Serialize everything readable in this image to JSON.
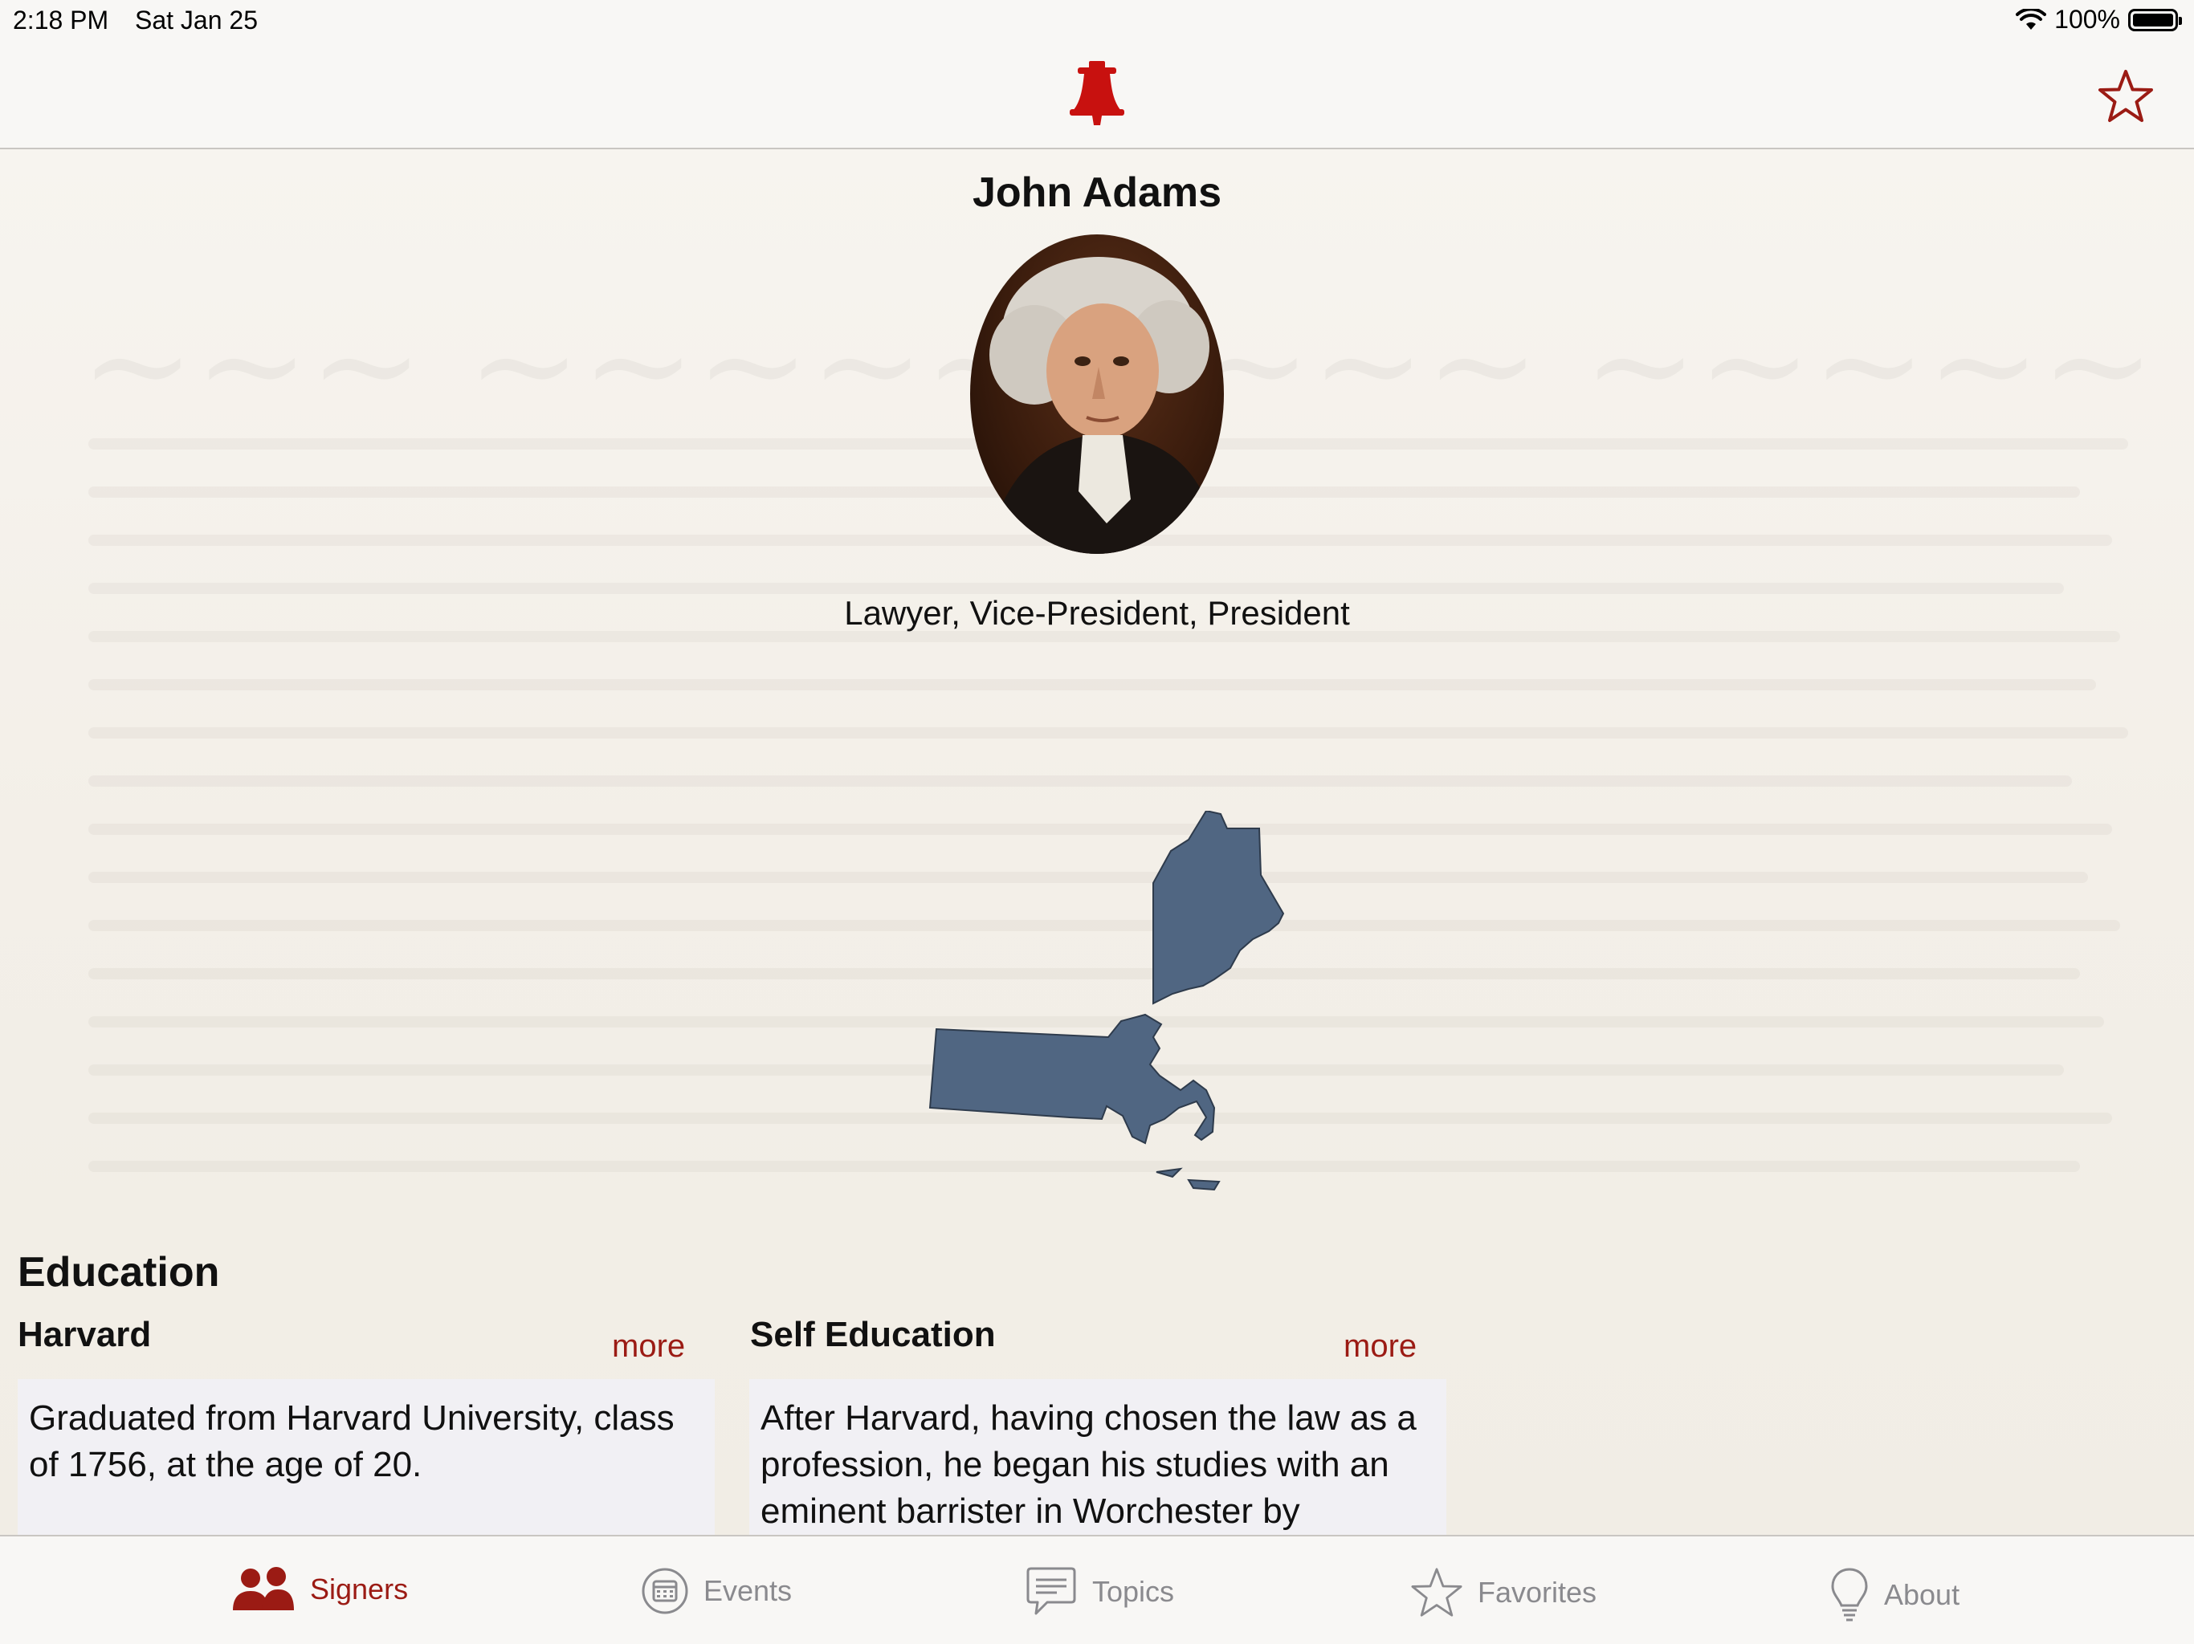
{
  "status_bar": {
    "time": "2:18 PM",
    "date": "Sat Jan 25",
    "battery": "100%",
    "wifi_icon": "wifi-icon",
    "battery_icon": "battery-icon"
  },
  "nav": {
    "logo_icon": "liberty-bell-icon",
    "favorite_icon": "star-outline-icon"
  },
  "signer": {
    "name": "John Adams",
    "roles": "Lawyer, Vice-President, President",
    "state_map_icon": "massachusetts-maine-map"
  },
  "education": {
    "title": "Education",
    "cards": [
      {
        "title": "Harvard",
        "more": "more",
        "text": "Graduated from Harvard University, class of 1756, at the age of 20."
      },
      {
        "title": "Self Education",
        "more": "more",
        "text": "After Harvard, having chosen the law as a profession, he began his studies with an eminent barrister in Worchester by"
      }
    ]
  },
  "tabs": [
    {
      "label": "Signers",
      "icon": "people-icon",
      "active": true
    },
    {
      "label": "Events",
      "icon": "calendar-icon",
      "active": false
    },
    {
      "label": "Topics",
      "icon": "speech-bubble-icon",
      "active": false
    },
    {
      "label": "Favorites",
      "icon": "star-icon",
      "active": false
    },
    {
      "label": "About",
      "icon": "lightbulb-icon",
      "active": false
    }
  ],
  "colors": {
    "accent": "#9b1b14",
    "map_fill": "#506682",
    "tab_inactive": "#8a8a8e"
  }
}
